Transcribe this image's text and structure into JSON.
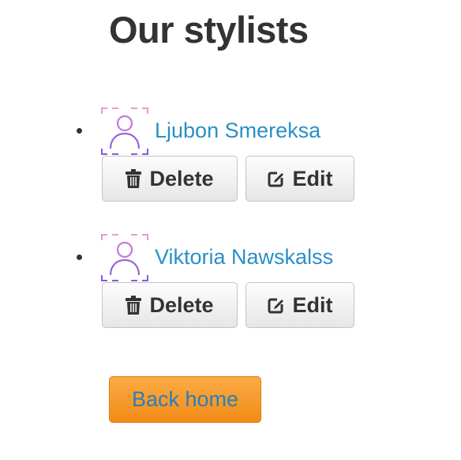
{
  "page": {
    "title": "Our stylists"
  },
  "stylists": [
    {
      "name": "Ljubon Smereksa",
      "delete_label": "Delete",
      "edit_label": "Edit",
      "avatar_icon": "user-placeholder-icon"
    },
    {
      "name": "Viktoria Nawskalss",
      "delete_label": "Delete",
      "edit_label": "Edit",
      "avatar_icon": "user-placeholder-icon"
    }
  ],
  "back_home": {
    "label": "Back home"
  },
  "icons": {
    "delete": "trash-icon",
    "edit": "edit-icon"
  },
  "colors": {
    "title": "#333333",
    "link": "#2a8fc7",
    "back_home_bg": "#f7951f",
    "back_home_text": "#2a7fb8",
    "button_bg": "#f0f0f0",
    "avatar_pink": "#e79ad6",
    "avatar_purple": "#8a5ad8"
  }
}
